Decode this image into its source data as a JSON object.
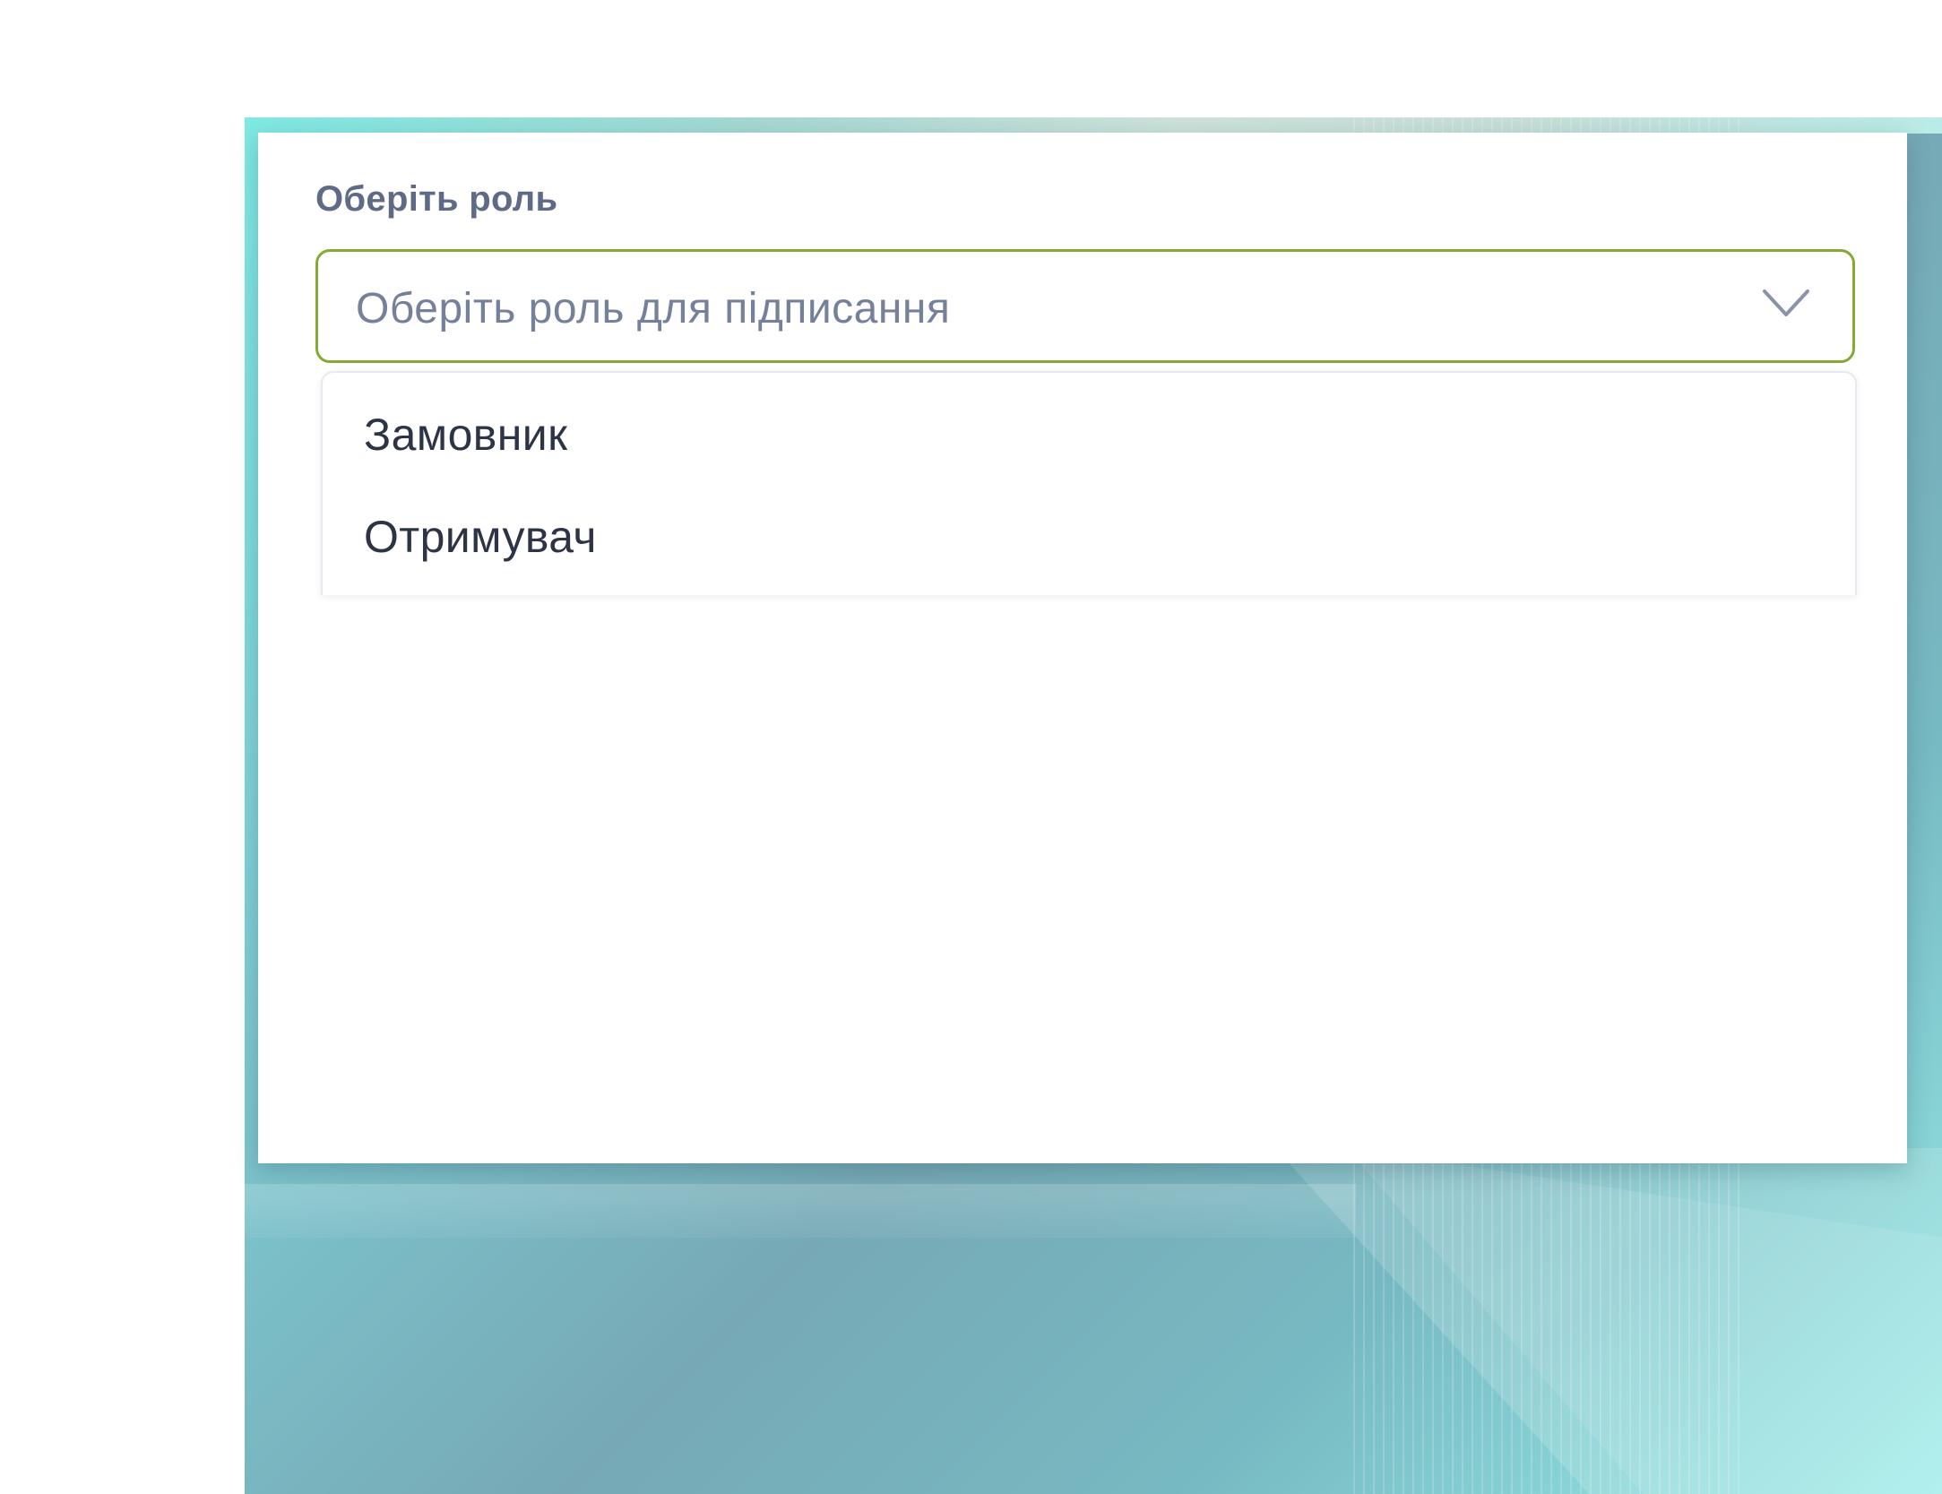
{
  "role_select": {
    "label": "Оберіть роль",
    "placeholder": "Оберіть роль для підписання",
    "options": [
      {
        "label": "Замовник"
      },
      {
        "label": "Отримувач"
      }
    ]
  },
  "icons": {
    "dropdown_toggle": "chevron-down-icon"
  },
  "colors": {
    "select_border": "#84a934",
    "label_text": "#5f6b86",
    "placeholder_text": "#75809b",
    "option_text": "#2c3446"
  }
}
